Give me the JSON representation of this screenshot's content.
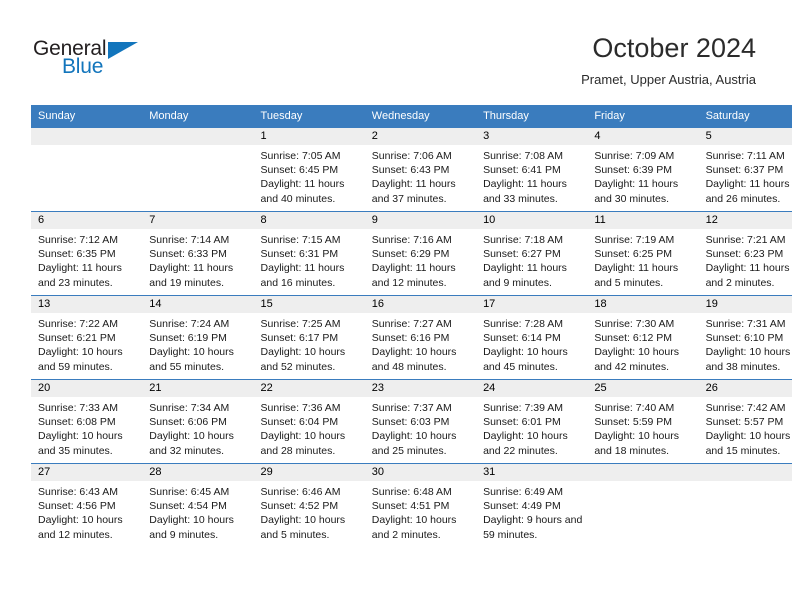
{
  "brand": {
    "name_part1": "General",
    "name_part2": "Blue",
    "accent_color": "#1275bc"
  },
  "header": {
    "title": "October 2024",
    "subtitle": "Pramet, Upper Austria, Austria"
  },
  "calendar": {
    "header_bg": "#3a7cbe",
    "weekday_headers": [
      "Sunday",
      "Monday",
      "Tuesday",
      "Wednesday",
      "Thursday",
      "Friday",
      "Saturday"
    ],
    "labels": {
      "sunrise": "Sunrise:",
      "sunset": "Sunset:",
      "daylight": "Daylight:"
    },
    "weeks": [
      [
        {
          "day": ""
        },
        {
          "day": ""
        },
        {
          "day": "1",
          "sunrise": "Sunrise: 7:05 AM",
          "sunset": "Sunset: 6:45 PM",
          "daylight": "Daylight: 11 hours and 40 minutes."
        },
        {
          "day": "2",
          "sunrise": "Sunrise: 7:06 AM",
          "sunset": "Sunset: 6:43 PM",
          "daylight": "Daylight: 11 hours and 37 minutes."
        },
        {
          "day": "3",
          "sunrise": "Sunrise: 7:08 AM",
          "sunset": "Sunset: 6:41 PM",
          "daylight": "Daylight: 11 hours and 33 minutes."
        },
        {
          "day": "4",
          "sunrise": "Sunrise: 7:09 AM",
          "sunset": "Sunset: 6:39 PM",
          "daylight": "Daylight: 11 hours and 30 minutes."
        },
        {
          "day": "5",
          "sunrise": "Sunrise: 7:11 AM",
          "sunset": "Sunset: 6:37 PM",
          "daylight": "Daylight: 11 hours and 26 minutes."
        }
      ],
      [
        {
          "day": "6",
          "sunrise": "Sunrise: 7:12 AM",
          "sunset": "Sunset: 6:35 PM",
          "daylight": "Daylight: 11 hours and 23 minutes."
        },
        {
          "day": "7",
          "sunrise": "Sunrise: 7:14 AM",
          "sunset": "Sunset: 6:33 PM",
          "daylight": "Daylight: 11 hours and 19 minutes."
        },
        {
          "day": "8",
          "sunrise": "Sunrise: 7:15 AM",
          "sunset": "Sunset: 6:31 PM",
          "daylight": "Daylight: 11 hours and 16 minutes."
        },
        {
          "day": "9",
          "sunrise": "Sunrise: 7:16 AM",
          "sunset": "Sunset: 6:29 PM",
          "daylight": "Daylight: 11 hours and 12 minutes."
        },
        {
          "day": "10",
          "sunrise": "Sunrise: 7:18 AM",
          "sunset": "Sunset: 6:27 PM",
          "daylight": "Daylight: 11 hours and 9 minutes."
        },
        {
          "day": "11",
          "sunrise": "Sunrise: 7:19 AM",
          "sunset": "Sunset: 6:25 PM",
          "daylight": "Daylight: 11 hours and 5 minutes."
        },
        {
          "day": "12",
          "sunrise": "Sunrise: 7:21 AM",
          "sunset": "Sunset: 6:23 PM",
          "daylight": "Daylight: 11 hours and 2 minutes."
        }
      ],
      [
        {
          "day": "13",
          "sunrise": "Sunrise: 7:22 AM",
          "sunset": "Sunset: 6:21 PM",
          "daylight": "Daylight: 10 hours and 59 minutes."
        },
        {
          "day": "14",
          "sunrise": "Sunrise: 7:24 AM",
          "sunset": "Sunset: 6:19 PM",
          "daylight": "Daylight: 10 hours and 55 minutes."
        },
        {
          "day": "15",
          "sunrise": "Sunrise: 7:25 AM",
          "sunset": "Sunset: 6:17 PM",
          "daylight": "Daylight: 10 hours and 52 minutes."
        },
        {
          "day": "16",
          "sunrise": "Sunrise: 7:27 AM",
          "sunset": "Sunset: 6:16 PM",
          "daylight": "Daylight: 10 hours and 48 minutes."
        },
        {
          "day": "17",
          "sunrise": "Sunrise: 7:28 AM",
          "sunset": "Sunset: 6:14 PM",
          "daylight": "Daylight: 10 hours and 45 minutes."
        },
        {
          "day": "18",
          "sunrise": "Sunrise: 7:30 AM",
          "sunset": "Sunset: 6:12 PM",
          "daylight": "Daylight: 10 hours and 42 minutes."
        },
        {
          "day": "19",
          "sunrise": "Sunrise: 7:31 AM",
          "sunset": "Sunset: 6:10 PM",
          "daylight": "Daylight: 10 hours and 38 minutes."
        }
      ],
      [
        {
          "day": "20",
          "sunrise": "Sunrise: 7:33 AM",
          "sunset": "Sunset: 6:08 PM",
          "daylight": "Daylight: 10 hours and 35 minutes."
        },
        {
          "day": "21",
          "sunrise": "Sunrise: 7:34 AM",
          "sunset": "Sunset: 6:06 PM",
          "daylight": "Daylight: 10 hours and 32 minutes."
        },
        {
          "day": "22",
          "sunrise": "Sunrise: 7:36 AM",
          "sunset": "Sunset: 6:04 PM",
          "daylight": "Daylight: 10 hours and 28 minutes."
        },
        {
          "day": "23",
          "sunrise": "Sunrise: 7:37 AM",
          "sunset": "Sunset: 6:03 PM",
          "daylight": "Daylight: 10 hours and 25 minutes."
        },
        {
          "day": "24",
          "sunrise": "Sunrise: 7:39 AM",
          "sunset": "Sunset: 6:01 PM",
          "daylight": "Daylight: 10 hours and 22 minutes."
        },
        {
          "day": "25",
          "sunrise": "Sunrise: 7:40 AM",
          "sunset": "Sunset: 5:59 PM",
          "daylight": "Daylight: 10 hours and 18 minutes."
        },
        {
          "day": "26",
          "sunrise": "Sunrise: 7:42 AM",
          "sunset": "Sunset: 5:57 PM",
          "daylight": "Daylight: 10 hours and 15 minutes."
        }
      ],
      [
        {
          "day": "27",
          "sunrise": "Sunrise: 6:43 AM",
          "sunset": "Sunset: 4:56 PM",
          "daylight": "Daylight: 10 hours and 12 minutes."
        },
        {
          "day": "28",
          "sunrise": "Sunrise: 6:45 AM",
          "sunset": "Sunset: 4:54 PM",
          "daylight": "Daylight: 10 hours and 9 minutes."
        },
        {
          "day": "29",
          "sunrise": "Sunrise: 6:46 AM",
          "sunset": "Sunset: 4:52 PM",
          "daylight": "Daylight: 10 hours and 5 minutes."
        },
        {
          "day": "30",
          "sunrise": "Sunrise: 6:48 AM",
          "sunset": "Sunset: 4:51 PM",
          "daylight": "Daylight: 10 hours and 2 minutes."
        },
        {
          "day": "31",
          "sunrise": "Sunrise: 6:49 AM",
          "sunset": "Sunset: 4:49 PM",
          "daylight": "Daylight: 9 hours and 59 minutes."
        },
        {
          "day": ""
        },
        {
          "day": ""
        }
      ]
    ]
  }
}
